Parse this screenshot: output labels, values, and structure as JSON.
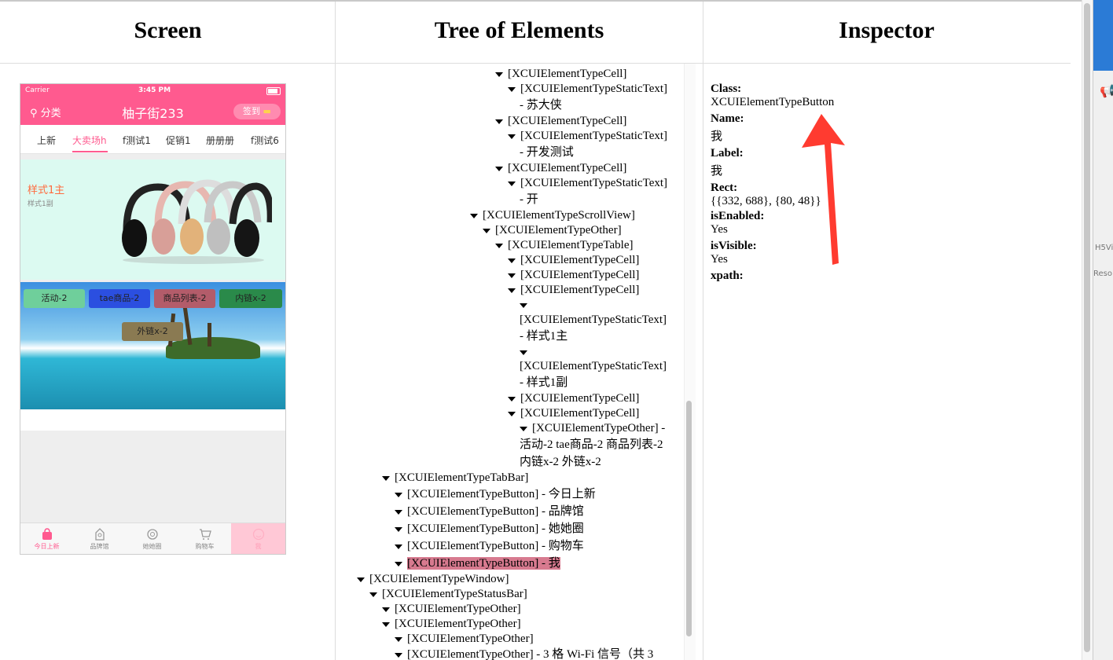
{
  "headers": {
    "screen": "Screen",
    "tree": "Tree of Elements",
    "inspector": "Inspector"
  },
  "phone": {
    "carrier": "Carrier",
    "time": "3:45 PM",
    "category": "分类",
    "title": "柚子街233",
    "signin": "签到",
    "tabs": [
      "上新",
      "大卖场h",
      "f测试1",
      "促销1",
      "册册册",
      "f测试6"
    ],
    "active_tab": "大卖场h",
    "banner_title": "样式1主",
    "banner_subtitle": "样式1副",
    "pills": [
      "活动-2",
      "tae商品-2",
      "商品列表-2",
      "内链x-2",
      "外链x-2"
    ],
    "tabbar": [
      "今日上新",
      "品牌馆",
      "她她圈",
      "购物车",
      "我"
    ]
  },
  "tree": {
    "rows": [
      "[XCUIElementTypeCell]",
      "[XCUIElementTypeStaticText]",
      "- 苏大侠",
      "[XCUIElementTypeCell]",
      "[XCUIElementTypeStaticText]",
      "- 开发测试",
      "[XCUIElementTypeCell]",
      "[XCUIElementTypeStaticText]",
      "- 开",
      "[XCUIElementTypeScrollView]",
      "[XCUIElementTypeOther]",
      "[XCUIElementTypeTable]",
      "[XCUIElementTypeCell]",
      "[XCUIElementTypeCell]",
      "[XCUIElementTypeCell]",
      "[XCUIElementTypeStaticText]",
      "- 样式1主",
      "[XCUIElementTypeStaticText]",
      "- 样式1副",
      "[XCUIElementTypeCell]",
      "[XCUIElementTypeCell]",
      "[XCUIElementTypeOther] -",
      "活动-2 tae商品-2 商品列表-2",
      "内链x-2 外链x-2",
      "[XCUIElementTypeTabBar]",
      "[XCUIElementTypeButton] - 今日上新",
      "[XCUIElementTypeButton] - 品牌馆",
      "[XCUIElementTypeButton] - 她她圈",
      "[XCUIElementTypeButton] - 购物车",
      "[XCUIElementTypeButton] - 我",
      "[XCUIElementTypeWindow]",
      "[XCUIElementTypeStatusBar]",
      "[XCUIElementTypeOther]",
      "[XCUIElementTypeOther]",
      "[XCUIElementTypeOther]",
      "[XCUIElementTypeOther] - 3 格 Wi-Fi 信号（共 3"
    ]
  },
  "inspector": {
    "class_label": "Class:",
    "class_value": "XCUIElementTypeButton",
    "name_label": "Name:",
    "name_value": "我",
    "label_label": "Label:",
    "label_value": "我",
    "rect_label": "Rect:",
    "rect_value": "{{332, 688}, {80, 48}}",
    "enabled_label": "isEnabled:",
    "enabled_value": "Yes",
    "visible_label": "isVisible:",
    "visible_value": "Yes",
    "xpath_label": "xpath:"
  },
  "side_panel": {
    "items": [
      "H5Vi",
      "Reso"
    ]
  },
  "colors": {
    "brand_pink": "#ff5a8f",
    "selection": "#d77a8f",
    "arrow": "#ff3b30"
  }
}
